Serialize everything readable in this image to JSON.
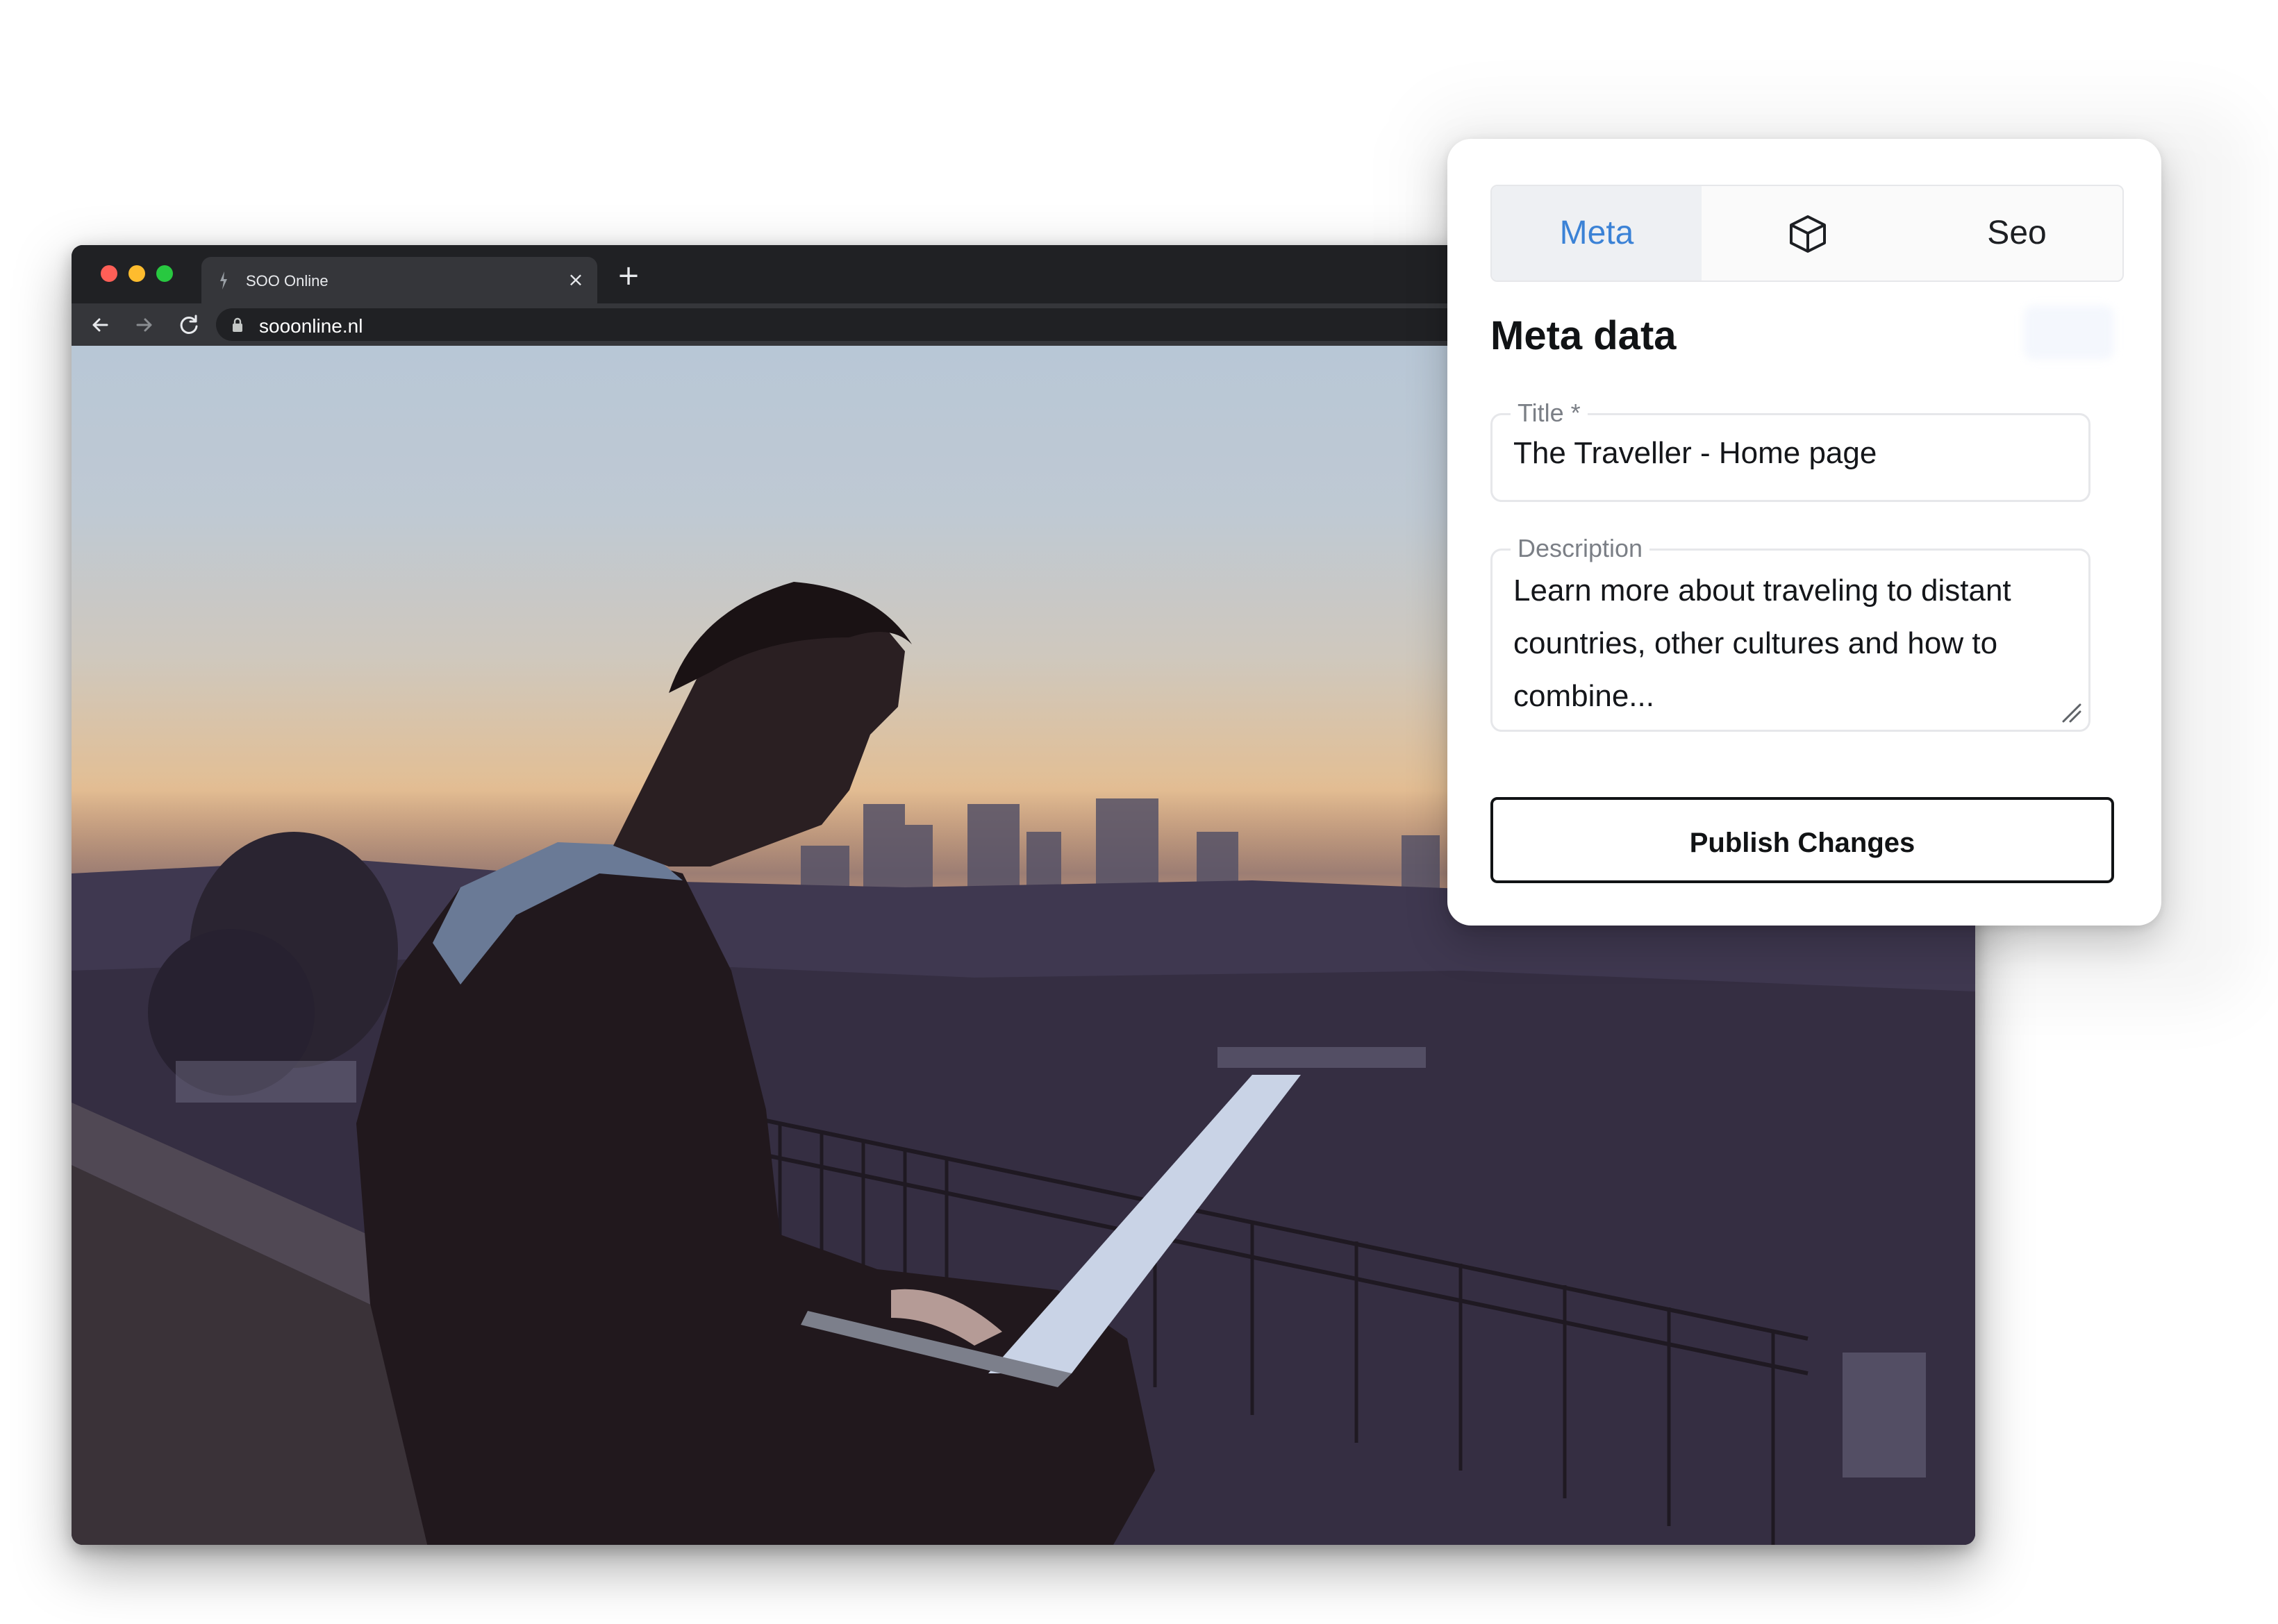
{
  "browser": {
    "tab_title": "SOO Online",
    "tab_close_glyph": "×",
    "new_tab_glyph": "+",
    "url": "sooonline.nl",
    "traffic_colors": {
      "close": "#ff5f57",
      "minimize": "#febc2e",
      "maximize": "#28c840"
    }
  },
  "hero": {
    "image_description": "person-with-laptop-at-dusk-over-city"
  },
  "panel": {
    "tabs": [
      {
        "label": "Meta",
        "active": true
      },
      {
        "label": "",
        "icon": "cube-icon",
        "active": false
      },
      {
        "label": "Seo",
        "active": false
      }
    ],
    "heading": "Meta data",
    "fields": {
      "title": {
        "label": "Title *",
        "value": "The Traveller - Home page"
      },
      "description": {
        "label": "Description",
        "value": "Learn more about traveling to distant countries, other cultures and how to combine..."
      }
    },
    "publish_label": "Publish Changes",
    "accent_color": "#3b82d6"
  }
}
